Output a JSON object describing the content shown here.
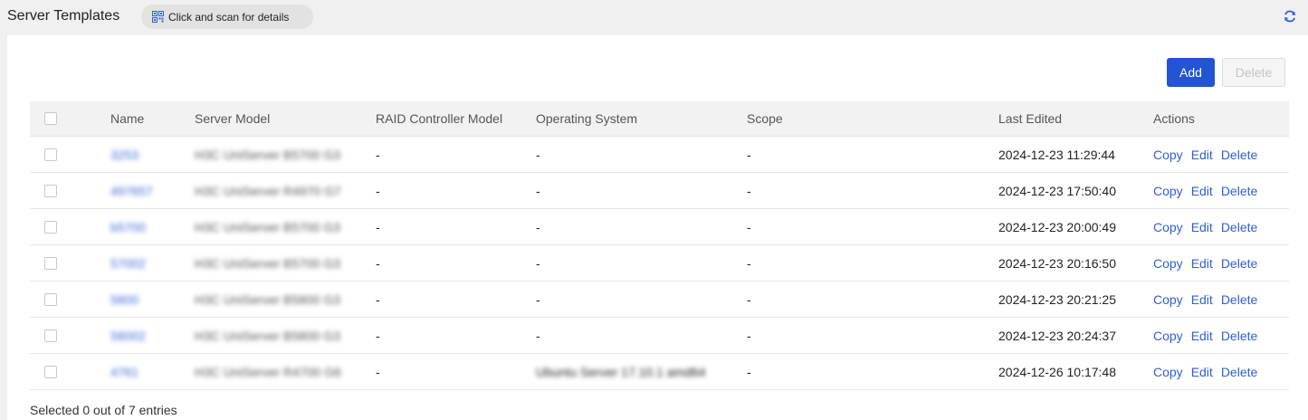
{
  "header": {
    "title": "Server Templates",
    "scan_label": "Click and scan for details",
    "icons": {
      "qr": "qr-code-icon",
      "refresh": "refresh-icon"
    }
  },
  "toolbar": {
    "add_label": "Add",
    "delete_label": "Delete"
  },
  "table": {
    "columns": [
      "Name",
      "Server Model",
      "RAID Controller Model",
      "Operating System",
      "Scope",
      "Last Edited",
      "Actions"
    ],
    "rows": [
      {
        "name": "3253",
        "model": "H3C UniServer B5700 G3",
        "raid": "-",
        "os": "-",
        "scope": "-",
        "edited": "2024-12-23 11:29:44"
      },
      {
        "name": "497657",
        "model": "H3C UniServer R4970 G7",
        "raid": "-",
        "os": "-",
        "scope": "-",
        "edited": "2024-12-23 17:50:40"
      },
      {
        "name": "b5700",
        "model": "H3C UniServer B5700 G3",
        "raid": "-",
        "os": "-",
        "scope": "-",
        "edited": "2024-12-23 20:00:49"
      },
      {
        "name": "57002",
        "model": "H3C UniServer B5700 G3",
        "raid": "-",
        "os": "-",
        "scope": "-",
        "edited": "2024-12-23 20:16:50"
      },
      {
        "name": "5800",
        "model": "H3C UniServer B5800 G3",
        "raid": "-",
        "os": "-",
        "scope": "-",
        "edited": "2024-12-23 20:21:25"
      },
      {
        "name": "58002",
        "model": "H3C UniServer B5800 G3",
        "raid": "-",
        "os": "-",
        "scope": "-",
        "edited": "2024-12-23 20:24:37"
      },
      {
        "name": "4761",
        "model": "H3C UniServer R4700 G6",
        "raid": "-",
        "os": "Ubuntu Server 17.10.1 amd64",
        "scope": "-",
        "edited": "2024-12-26 10:17:48"
      }
    ],
    "actions": {
      "copy": "Copy",
      "edit": "Edit",
      "delete": "Delete"
    }
  },
  "footer": {
    "selection_text": "Selected 0 out of 7 entries"
  },
  "colors": {
    "accent": "#2254d3",
    "link": "#2e5fd3",
    "header_bg": "#f2f2f2",
    "page_bg": "#f0f0f0"
  }
}
